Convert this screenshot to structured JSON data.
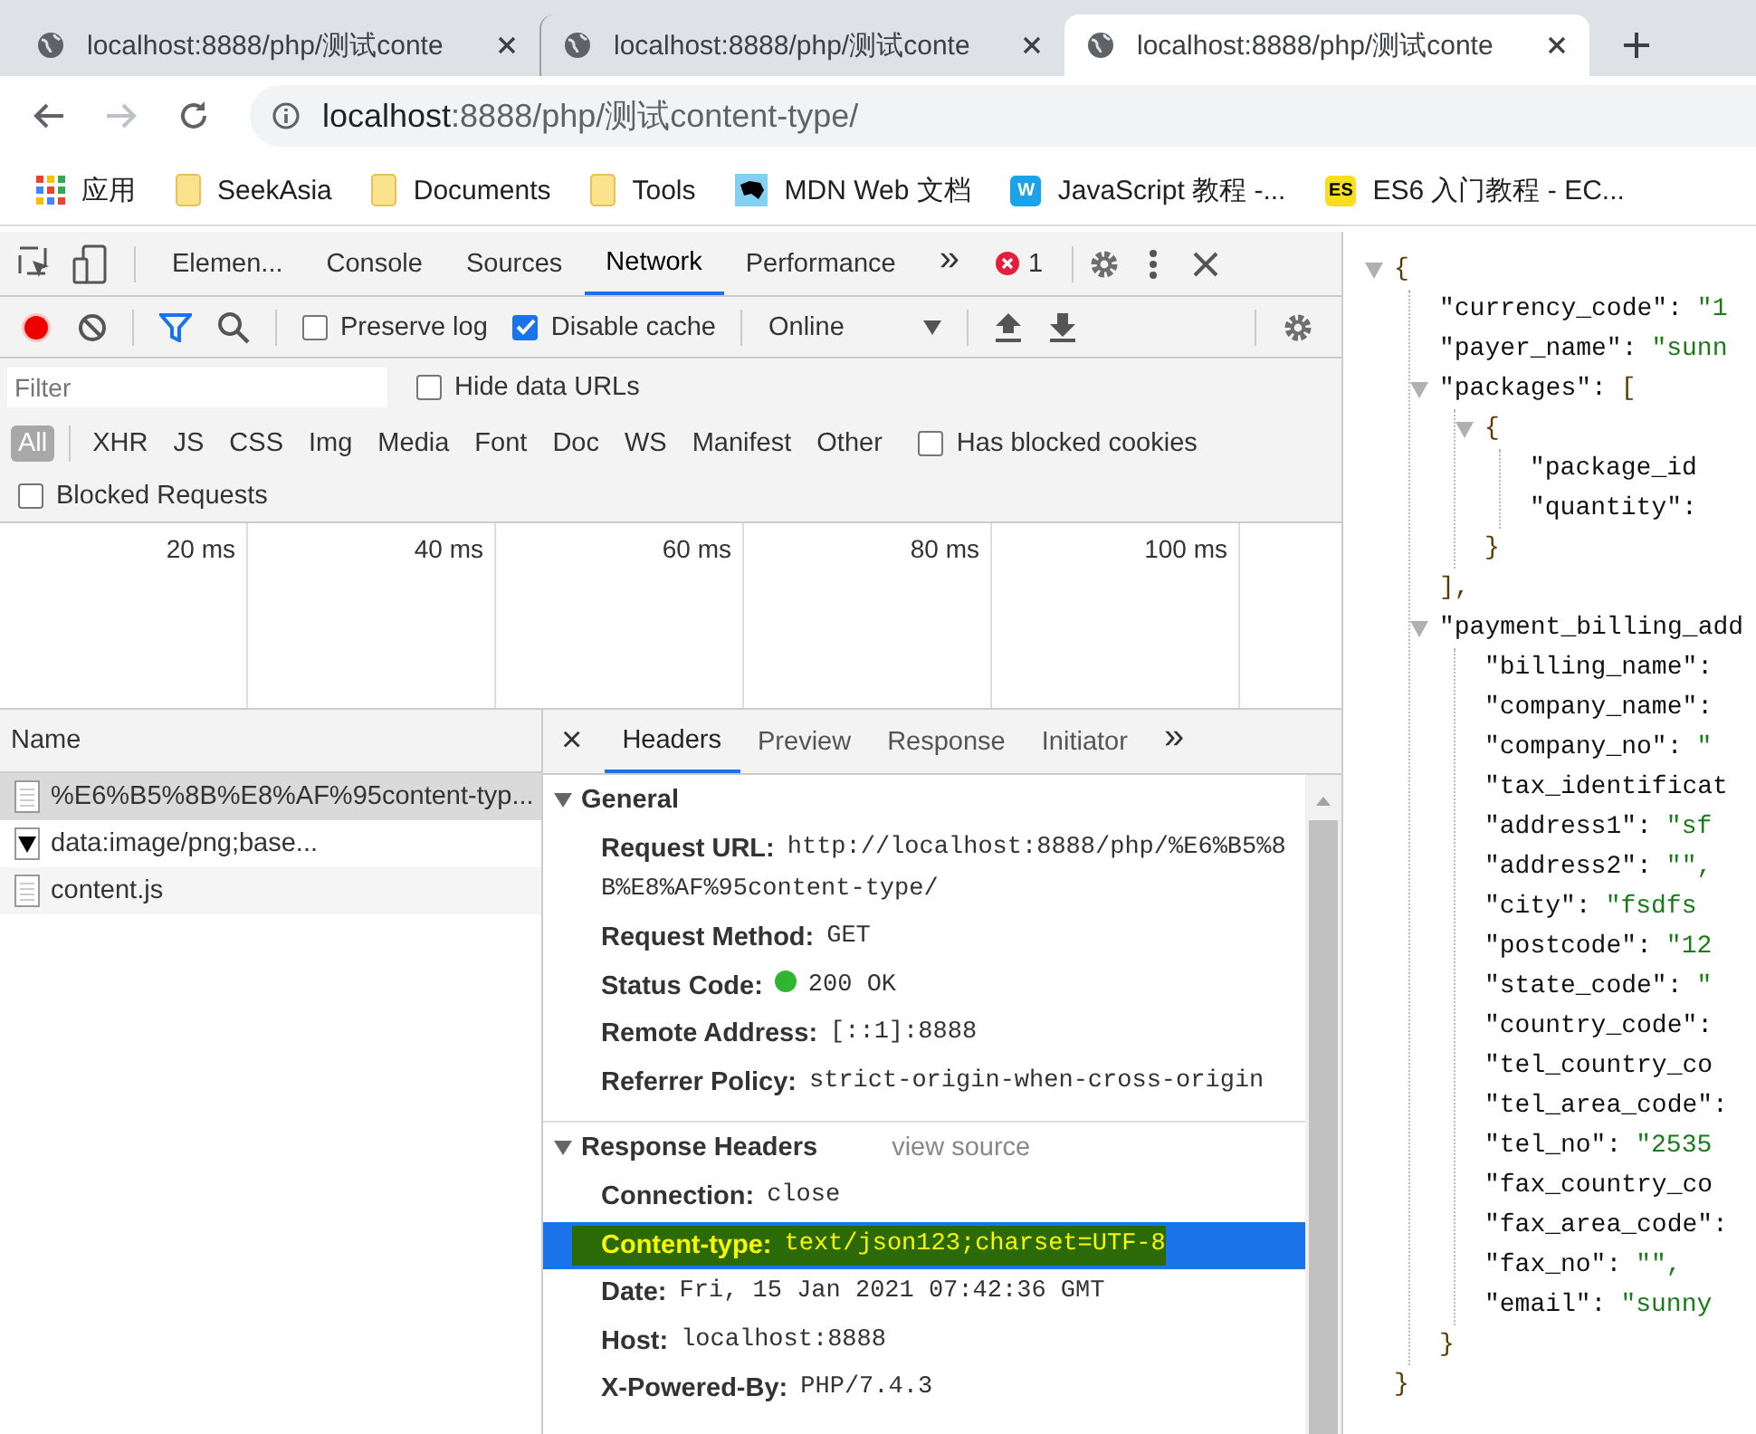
{
  "browser": {
    "tabs": [
      {
        "title": "localhost:8888/php/测试conte",
        "selected": false
      },
      {
        "title": "localhost:8888/php/测试conte",
        "selected": false
      },
      {
        "title": "localhost:8888/php/测试conte",
        "selected": true
      }
    ],
    "address": {
      "host": "localhost",
      "rest": ":8888/php/测试content-type/"
    },
    "bookmarks": [
      {
        "label": "应用",
        "kind": "apps"
      },
      {
        "label": "SeekAsia",
        "kind": "folder"
      },
      {
        "label": "Documents",
        "kind": "folder"
      },
      {
        "label": "Tools",
        "kind": "folder"
      },
      {
        "label": "MDN Web 文档",
        "kind": "mdn"
      },
      {
        "label": "JavaScript 教程 -...",
        "kind": "badge",
        "icon_text": "W",
        "color": "#1aa3e8"
      },
      {
        "label": "ES6 入门教程 - EC...",
        "kind": "badge",
        "icon_text": "ES",
        "color": "#f7df1e"
      }
    ]
  },
  "devtools": {
    "panel_tabs": [
      {
        "label": "Elemen...",
        "selected": false
      },
      {
        "label": "Console",
        "selected": false
      },
      {
        "label": "Sources",
        "selected": false
      },
      {
        "label": "Network",
        "selected": true
      },
      {
        "label": "Performance",
        "selected": false
      }
    ],
    "more": "»",
    "error_count": "1",
    "toolbar": {
      "recording": true,
      "preserve_log": {
        "label": "Preserve log",
        "checked": false
      },
      "disable_cache": {
        "label": "Disable cache",
        "checked": true
      },
      "throttling": "Online"
    },
    "filter": {
      "placeholder": "Filter",
      "hide_data_urls": {
        "label": "Hide data URLs",
        "checked": false
      }
    },
    "types": [
      {
        "label": "All",
        "selected": true
      },
      {
        "label": "XHR",
        "selected": false
      },
      {
        "label": "JS",
        "selected": false
      },
      {
        "label": "CSS",
        "selected": false
      },
      {
        "label": "Img",
        "selected": false
      },
      {
        "label": "Media",
        "selected": false
      },
      {
        "label": "Font",
        "selected": false
      },
      {
        "label": "Doc",
        "selected": false
      },
      {
        "label": "WS",
        "selected": false
      },
      {
        "label": "Manifest",
        "selected": false
      },
      {
        "label": "Other",
        "selected": false
      }
    ],
    "has_blocked_cookies": {
      "label": "Has blocked cookies",
      "checked": false
    },
    "blocked_requests": {
      "label": "Blocked Requests",
      "checked": false
    },
    "timeline_ticks": [
      "20 ms",
      "40 ms",
      "60 ms",
      "80 ms",
      "100 ms"
    ],
    "requests": {
      "column": "Name",
      "rows": [
        {
          "name": "%E6%B5%8B%E8%AF%95content-typ...",
          "kind": "document",
          "selected": true
        },
        {
          "name": "data:image/png;base...",
          "kind": "image",
          "selected": false
        },
        {
          "name": "content.js",
          "kind": "script",
          "selected": false
        }
      ]
    },
    "detail": {
      "close": "×",
      "tabs": [
        {
          "label": "Headers",
          "selected": true
        },
        {
          "label": "Preview",
          "selected": false
        },
        {
          "label": "Response",
          "selected": false
        },
        {
          "label": "Initiator",
          "selected": false
        }
      ],
      "more": "»",
      "sections": [
        {
          "title": "General",
          "expanded": true,
          "rows": [
            {
              "name": "Request URL:",
              "value": "http://localhost:8888/php/%E6%B5%8B%E8%AF%95content-type/",
              "selected": false,
              "highlighted": false
            },
            {
              "name": "Request Method:",
              "value": "GET",
              "selected": false,
              "highlighted": false
            },
            {
              "name": "Status Code:",
              "value": "200 OK",
              "color": "#2fb52f",
              "selected": false,
              "highlighted": false
            },
            {
              "name": "Remote Address:",
              "value": "[::1]:8888",
              "selected": false,
              "highlighted": false
            },
            {
              "name": "Referrer Policy:",
              "value": "strict-origin-when-cross-origin",
              "selected": false,
              "highlighted": false
            }
          ]
        },
        {
          "title": "Response Headers",
          "expanded": true,
          "link": "view source",
          "rows": [
            {
              "name": "Connection:",
              "value": "close",
              "selected": false,
              "highlighted": false
            },
            {
              "name": "Content-type:",
              "value": "text/json123;charset=UTF-8",
              "selected": true,
              "highlighted": true
            },
            {
              "name": "Date:",
              "value": "Fri, 15 Jan 2021 07:42:36 GMT",
              "selected": false,
              "highlighted": false
            },
            {
              "name": "Host:",
              "value": "localhost:8888",
              "selected": false,
              "highlighted": false
            },
            {
              "name": "X-Powered-By:",
              "value": "PHP/7.4.3",
              "selected": false,
              "highlighted": false
            }
          ]
        }
      ]
    }
  },
  "json_view": {
    "open": "{",
    "expanded": true,
    "close": "}",
    "children": [
      {
        "key": "\"currency_code\":",
        "value": "\"1"
      },
      {
        "key": "\"payer_name\":",
        "value": "\"sunn"
      },
      {
        "key": "\"packages\":",
        "open": "[",
        "expanded": true,
        "close": "],",
        "children": [
          {
            "open": "{",
            "expanded": true,
            "close": "}",
            "children": [
              {
                "key": "\"package_id"
              },
              {
                "key": "\"quantity\":"
              }
            ]
          }
        ]
      },
      {
        "key": "\"payment_billing_add",
        "expanded": true,
        "close": "}",
        "children": [
          {
            "key": "\"billing_name\":"
          },
          {
            "key": "\"company_name\":"
          },
          {
            "key": "\"company_no\":",
            "value": "\""
          },
          {
            "key": "\"tax_identificat"
          },
          {
            "key": "\"address1\":",
            "value": "\"sf"
          },
          {
            "key": "\"address2\":",
            "value": "\"\","
          },
          {
            "key": "\"city\":",
            "value": "\"fsdfs"
          },
          {
            "key": "\"postcode\":",
            "value": "\"12"
          },
          {
            "key": "\"state_code\":",
            "value": "\""
          },
          {
            "key": "\"country_code\":"
          },
          {
            "key": "\"tel_country_co"
          },
          {
            "key": "\"tel_area_code\":"
          },
          {
            "key": "\"tel_no\":",
            "value": "\"2535"
          },
          {
            "key": "\"fax_country_co"
          },
          {
            "key": "\"fax_area_code\":"
          },
          {
            "key": "\"fax_no\":",
            "value": "\"\","
          },
          {
            "key": "\"email\":",
            "value": "\"sunny"
          }
        ]
      }
    ]
  }
}
